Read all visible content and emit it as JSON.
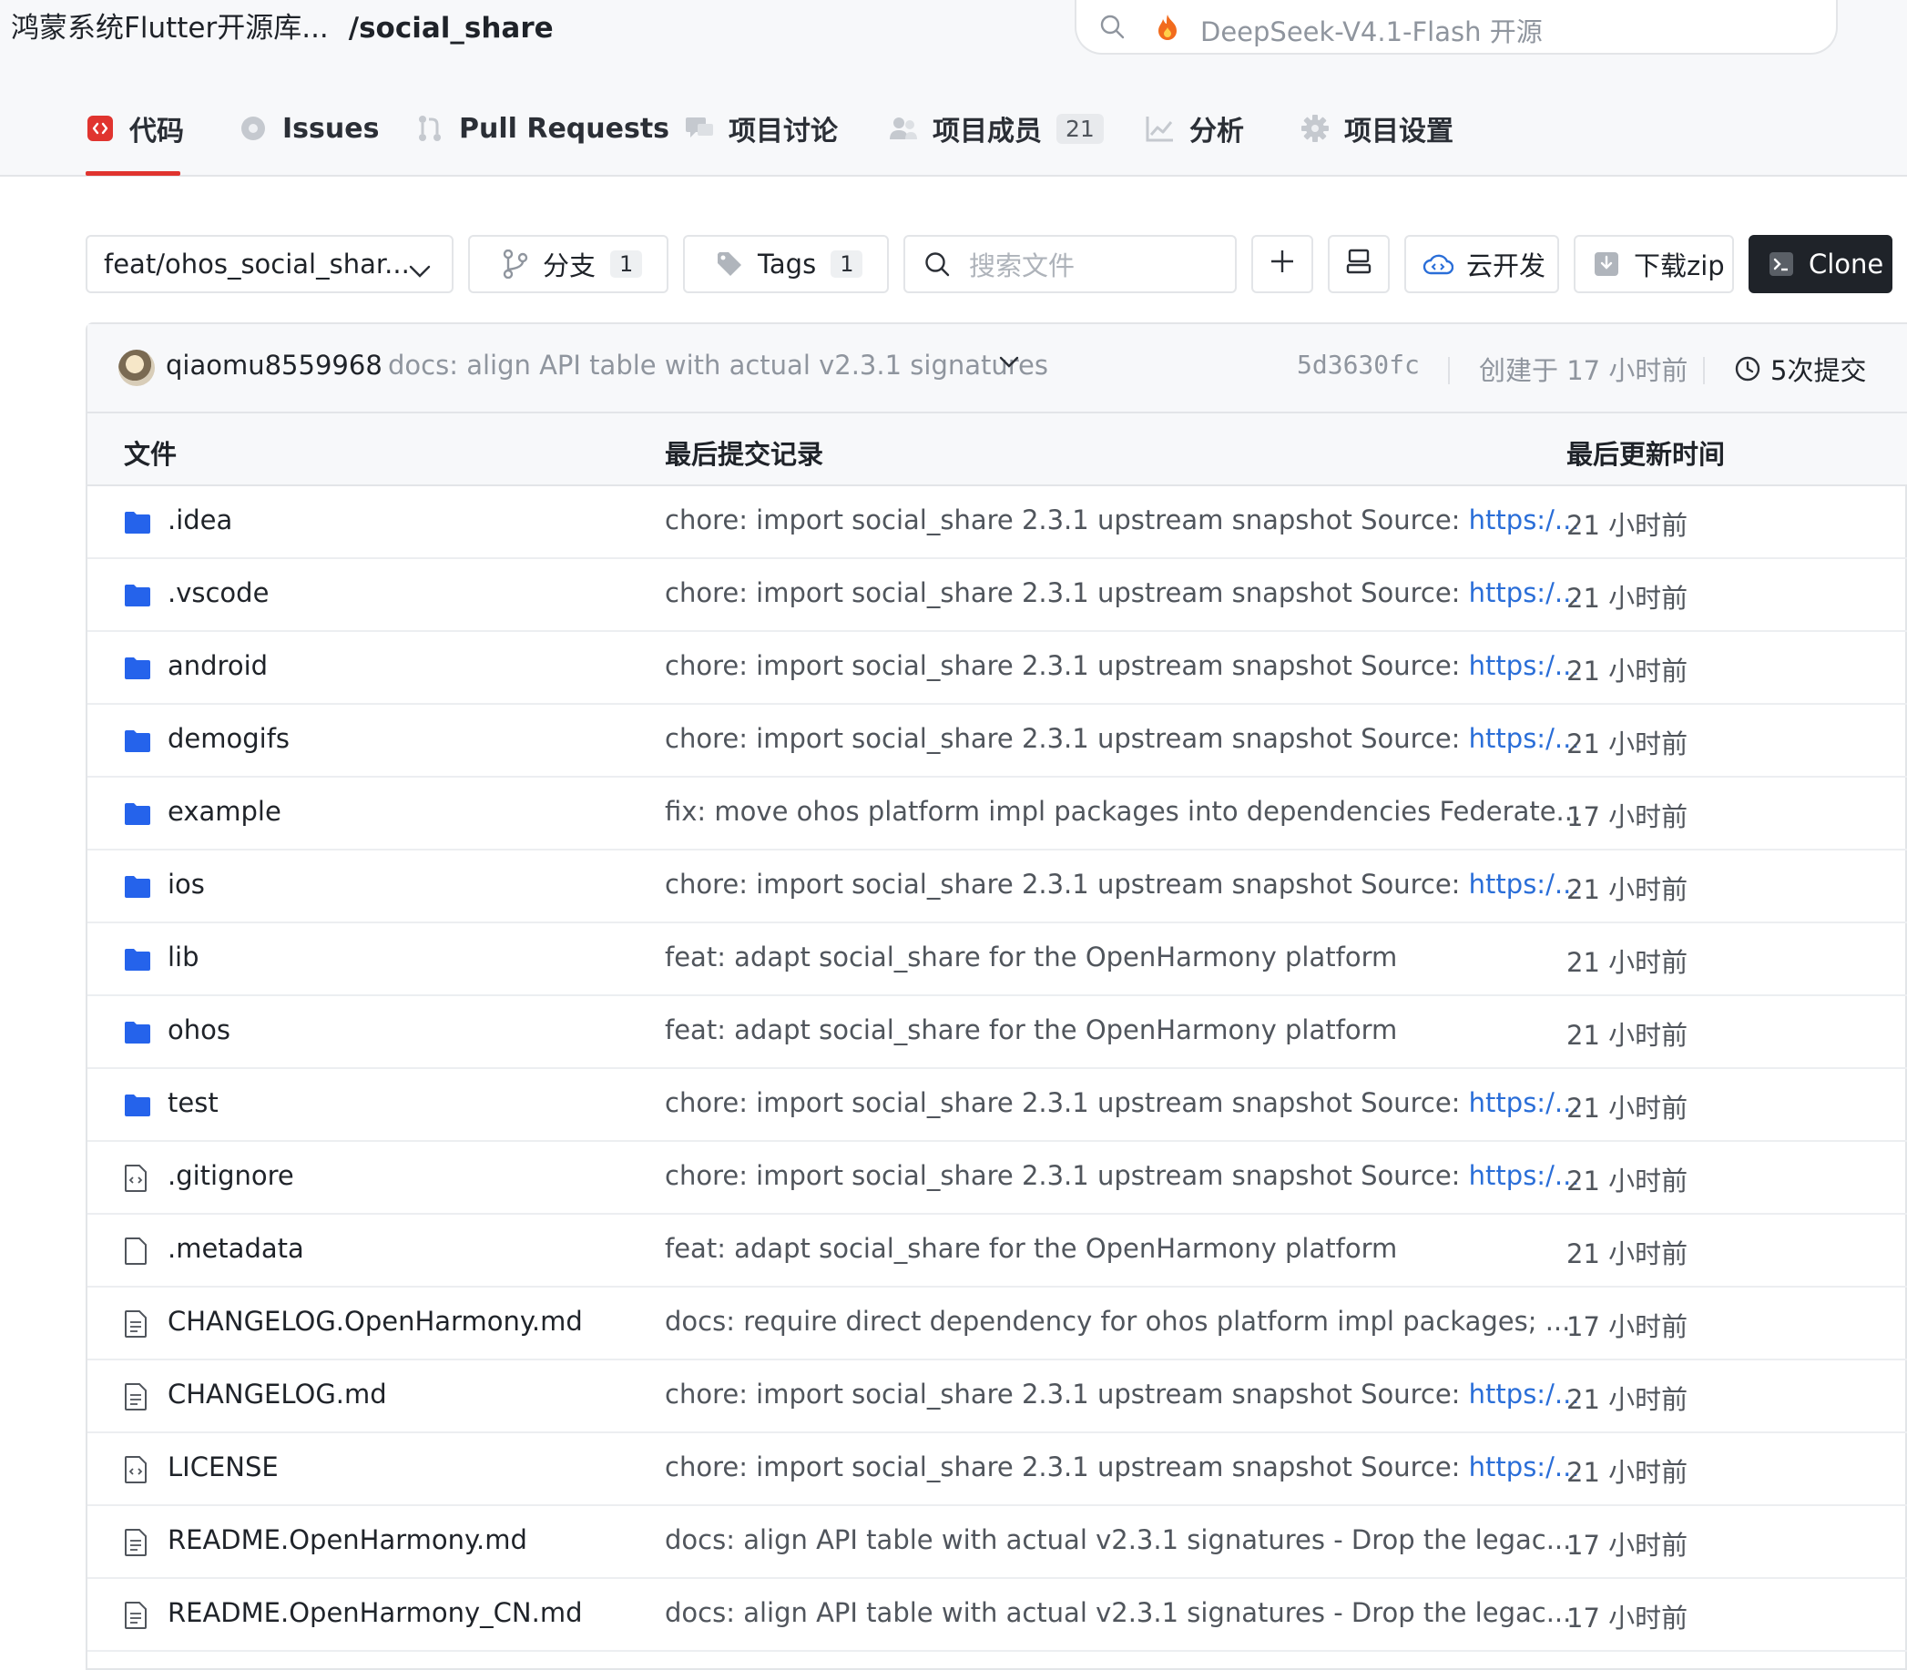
{
  "header": {
    "repo_owner": "鸿蒙系统Flutter开源库...",
    "repo_name": "/social_share",
    "search_text": "DeepSeek-V4.1-Flash 开源"
  },
  "tabs": [
    {
      "label": "代码",
      "icon": "code-icon",
      "active": true
    },
    {
      "label": "Issues",
      "icon": "issues-icon"
    },
    {
      "label": "Pull Requests",
      "icon": "pull-request-icon"
    },
    {
      "label": "项目讨论",
      "icon": "discussion-icon"
    },
    {
      "label": "项目成员",
      "icon": "members-icon",
      "badge": "21"
    },
    {
      "label": "分析",
      "icon": "analytics-icon"
    },
    {
      "label": "项目设置",
      "icon": "settings-icon"
    }
  ],
  "toolbar": {
    "branch": "feat/ohos_social_shar...",
    "branches_label": "分支",
    "branches_count": "1",
    "tags_label": "Tags",
    "tags_count": "1",
    "search_placeholder": "搜索文件",
    "cloud_dev_label": "云开发",
    "download_label": "下载zip",
    "clone_label": "Clone"
  },
  "last_commit": {
    "author": "qiaomu8559968",
    "message": "docs: align API table with actual v2.3.1 signatures",
    "hash": "5d3630fc",
    "created": "创建于 17 小时前",
    "commit_count": "5次提交"
  },
  "table": {
    "headers": {
      "file": "文件",
      "commit": "最后提交记录",
      "time": "最后更新时间"
    },
    "rows": [
      {
        "name": ".idea",
        "type": "folder",
        "msg": "chore: import social_share 2.3.1 upstream snapshot Source: ",
        "link": "https:/...",
        "time": "21 小时前"
      },
      {
        "name": ".vscode",
        "type": "folder",
        "msg": "chore: import social_share 2.3.1 upstream snapshot Source: ",
        "link": "https:/...",
        "time": "21 小时前"
      },
      {
        "name": "android",
        "type": "folder",
        "msg": "chore: import social_share 2.3.1 upstream snapshot Source: ",
        "link": "https:/...",
        "time": "21 小时前"
      },
      {
        "name": "demogifs",
        "type": "folder",
        "msg": "chore: import social_share 2.3.1 upstream snapshot Source: ",
        "link": "https:/...",
        "time": "21 小时前"
      },
      {
        "name": "example",
        "type": "folder",
        "msg": "fix: move ohos platform impl packages into dependencies Federate...",
        "link": "",
        "time": "17 小时前"
      },
      {
        "name": "ios",
        "type": "folder",
        "msg": "chore: import social_share 2.3.1 upstream snapshot Source: ",
        "link": "https:/...",
        "time": "21 小时前"
      },
      {
        "name": "lib",
        "type": "folder",
        "msg": "feat: adapt social_share for the OpenHarmony platform",
        "link": "",
        "time": "21 小时前"
      },
      {
        "name": "ohos",
        "type": "folder",
        "msg": "feat: adapt social_share for the OpenHarmony platform",
        "link": "",
        "time": "21 小时前"
      },
      {
        "name": "test",
        "type": "folder",
        "msg": "chore: import social_share 2.3.1 upstream snapshot Source: ",
        "link": "https:/...",
        "time": "21 小时前"
      },
      {
        "name": ".gitignore",
        "type": "code",
        "msg": "chore: import social_share 2.3.1 upstream snapshot Source: ",
        "link": "https:/...",
        "time": "21 小时前"
      },
      {
        "name": ".metadata",
        "type": "file",
        "msg": "feat: adapt social_share for the OpenHarmony platform",
        "link": "",
        "time": "21 小时前"
      },
      {
        "name": "CHANGELOG.OpenHarmony.md",
        "type": "doc",
        "msg": "docs: require direct dependency for ohos platform impl packages; ...",
        "link": "",
        "time": "17 小时前"
      },
      {
        "name": "CHANGELOG.md",
        "type": "doc",
        "msg": "chore: import social_share 2.3.1 upstream snapshot Source: ",
        "link": "https:/...",
        "time": "21 小时前"
      },
      {
        "name": "LICENSE",
        "type": "code",
        "msg": "chore: import social_share 2.3.1 upstream snapshot Source: ",
        "link": "https:/...",
        "time": "21 小时前"
      },
      {
        "name": "README.OpenHarmony.md",
        "type": "doc",
        "msg": "docs: align API table with actual v2.3.1 signatures - Drop the legac...",
        "link": "",
        "time": "17 小时前"
      },
      {
        "name": "README.OpenHarmony_CN.md",
        "type": "doc",
        "msg": "docs: align API table with actual v2.3.1 signatures - Drop the legac...",
        "link": "",
        "time": "17 小时前"
      }
    ]
  },
  "colors": {
    "accent": "#e0342f",
    "link": "#2a6ed8",
    "folder": "#2563eb",
    "clone_bg": "#1f2329"
  }
}
